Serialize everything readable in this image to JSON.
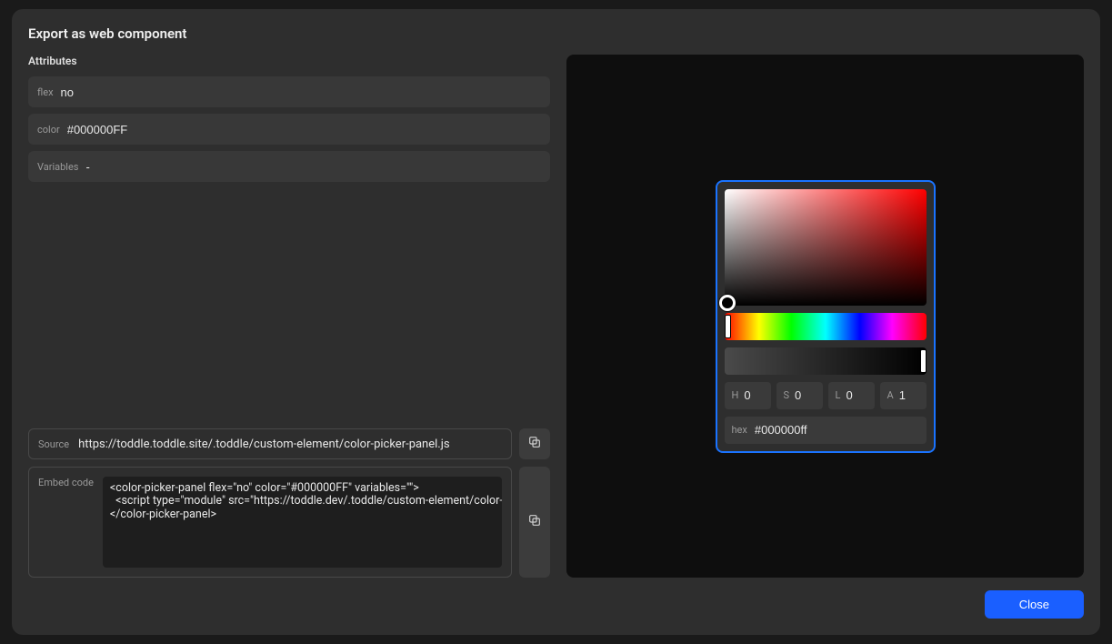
{
  "dialog": {
    "title": "Export as web component"
  },
  "attributes": {
    "section_label": "Attributes",
    "items": [
      {
        "key": "flex",
        "value": "no"
      },
      {
        "key": "color",
        "value": "#000000FF"
      },
      {
        "key": "Variables",
        "value": "-"
      }
    ]
  },
  "source": {
    "label": "Source",
    "value": "https://toddle.toddle.site/.toddle/custom-element/color-picker-panel.js"
  },
  "embed": {
    "label": "Embed code",
    "value": "<color-picker-panel flex=\"no\" color=\"#000000FF\" variables=\"\">\n  <script type=\"module\" src=\"https://toddle.dev/.toddle/custom-element/color-picker-panel.js\">\n</color-picker-panel>"
  },
  "picker": {
    "h": {
      "label": "H",
      "value": "0"
    },
    "s": {
      "label": "S",
      "value": "0"
    },
    "l": {
      "label": "L",
      "value": "0"
    },
    "a": {
      "label": "A",
      "value": "1"
    },
    "hex": {
      "label": "hex",
      "value": "#000000ff"
    }
  },
  "footer": {
    "close_label": "Close"
  },
  "colors": {
    "accent": "#1a5fff"
  }
}
